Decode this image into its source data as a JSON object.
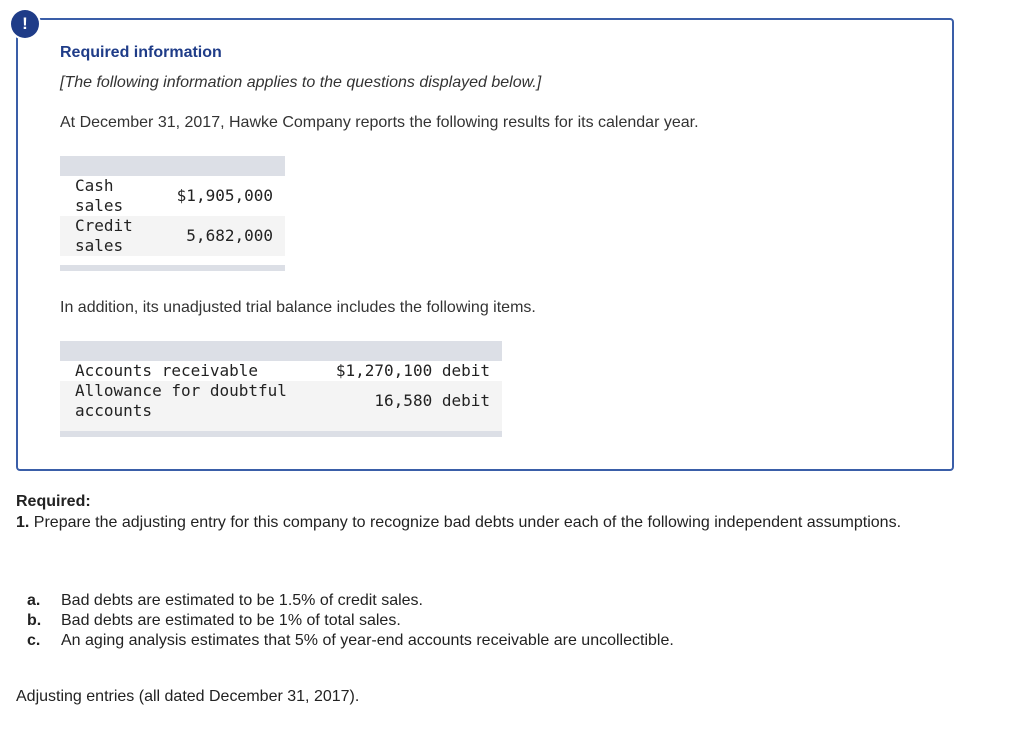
{
  "alert": {
    "symbol": "!"
  },
  "info": {
    "title": "Required information",
    "note": "[The following information applies to the questions displayed below.]",
    "intro": "At December 31, 2017, Hawke Company reports the following results for its calendar year.",
    "addition": "In addition, its unadjusted trial balance includes the following items."
  },
  "sales_table": {
    "rows": [
      {
        "label": "Cash sales",
        "value": "$1,905,000"
      },
      {
        "label": "Credit sales",
        "value": "5,682,000"
      }
    ]
  },
  "balance_table": {
    "rows": [
      {
        "label": "Accounts receivable",
        "value": "$1,270,100 debit"
      },
      {
        "label": "Allowance for doubtful accounts",
        "value": "16,580 debit"
      }
    ]
  },
  "required": {
    "heading": "Required:",
    "item_number": "1.",
    "item_text": "Prepare the adjusting entry for this company to recognize bad debts under each of the following independent assumptions.",
    "assumptions": [
      {
        "letter": "a.",
        "text": "Bad debts are estimated to be 1.5% of credit sales."
      },
      {
        "letter": "b.",
        "text": "Bad debts are estimated to be 1% of total sales."
      },
      {
        "letter": "c.",
        "text": "An aging analysis estimates that 5% of year-end accounts receivable are uncollectible."
      }
    ]
  },
  "footer": {
    "adjusting_label": "Adjusting entries (all dated December 31, 2017)."
  },
  "colors": {
    "accent": "#1f3c88",
    "panel_border": "#3a5ea8",
    "table_bar": "#dcdfe6"
  }
}
